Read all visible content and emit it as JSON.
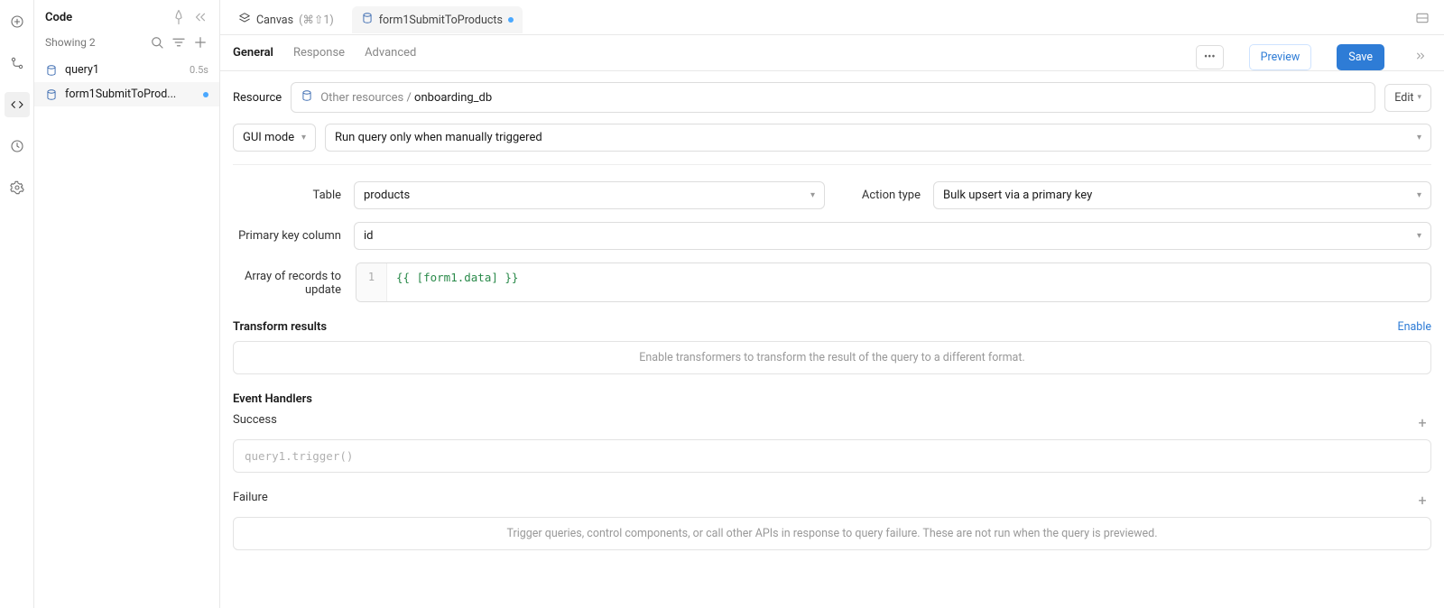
{
  "panel": {
    "title": "Code",
    "showing": "Showing 2",
    "items": [
      {
        "name": "query1",
        "meta": "0.5s"
      },
      {
        "name": "form1SubmitToProd..."
      }
    ]
  },
  "tabs": {
    "canvas": "Canvas",
    "canvas_hint": "(⌘⇧1)",
    "active": "form1SubmitToProducts"
  },
  "subtabs": {
    "general": "General",
    "response": "Response",
    "advanced": "Advanced"
  },
  "actions": {
    "preview": "Preview",
    "save": "Save"
  },
  "resource": {
    "label": "Resource",
    "path": "Other resources / ",
    "db": "onboarding_db",
    "edit": "Edit"
  },
  "mode": {
    "gui": "GUI mode",
    "run": "Run query only when manually triggered"
  },
  "form": {
    "table_label": "Table",
    "table_value": "products",
    "action_label": "Action type",
    "action_value": "Bulk upsert via a primary key",
    "pk_label": "Primary key column",
    "pk_value": "id",
    "array_label": "Array of records to update",
    "array_code": "{{ [form1.data] }}",
    "gutter": "1"
  },
  "transform": {
    "title": "Transform results",
    "enable": "Enable",
    "placeholder": "Enable transformers to transform the result of the query to a different format."
  },
  "handlers": {
    "title": "Event Handlers",
    "success": "Success",
    "success_code": "query1.trigger()",
    "failure": "Failure",
    "failure_placeholder": "Trigger queries, control components, or call other APIs in response to query failure. These are not run when the query is previewed."
  }
}
